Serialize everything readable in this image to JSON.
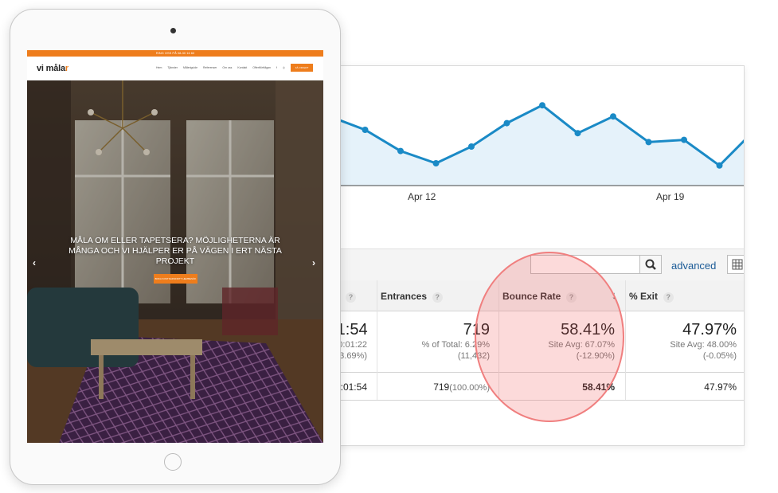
{
  "analytics": {
    "x_ticks": [
      "Apr 12",
      "Apr 19"
    ],
    "toolbar": {
      "advanced_label": "advanced"
    },
    "columns": [
      {
        "label": "Entrances"
      },
      {
        "label": "Bounce Rate"
      },
      {
        "label": "% Exit"
      }
    ],
    "summary_row": {
      "partial_time": ":01:54",
      "partial_time_sub1": "0:01:22",
      "partial_time_sub2": "3.69%)",
      "entrances": "719",
      "entrances_sub1": "% of Total: 6.29%",
      "entrances_sub2": "(11,432)",
      "bounce": "58.41%",
      "bounce_sub1": "Site Avg: 67.07%",
      "bounce_sub2": "(-12.90%)",
      "exit": "47.97%",
      "exit_sub1": "Site Avg: 48.00%",
      "exit_sub2": "(-0.05%)"
    },
    "total_row": {
      "partial_time": ":01:54",
      "entrances": "719",
      "entrances_pct": "(100.00%)",
      "bounce": "58.41%",
      "exit": "47.97%"
    }
  },
  "chart_data": {
    "type": "area",
    "x": [
      "",
      "",
      "",
      "",
      "",
      "",
      "",
      "",
      "",
      "",
      "",
      "",
      ""
    ],
    "x_tick_labels": [
      "Apr 12",
      "Apr 19"
    ],
    "series": [
      {
        "values": [
          62,
          50,
          31,
          20,
          35,
          56,
          72,
          47,
          62,
          39,
          41,
          18,
          50
        ]
      }
    ],
    "ylim": [
      0,
      100
    ],
    "colors": {
      "line": "#1a8ac6",
      "fill": "#e5f2fa"
    }
  },
  "tablet": {
    "topbar": "RING OSS PÅ 08-30 16 60",
    "logo_a": "vi måla",
    "logo_b": "r",
    "nav": [
      "Hem",
      "Tjänster",
      "Måleriguide",
      "Referenser",
      "Om oss",
      "Kontakt",
      "Offertförfrågan"
    ],
    "nav_cta": "FÅ OFFERT",
    "hero_text": "MÅLA OM ELLER TAPETSERA? MÖJLIGHETERNA ÄR MÅNGA OCH VI HJÄLPER ER PÅ VÄGEN I ERT NÄSTA PROJEKT",
    "hero_button": "BOKA KOSTNADSFRITT HEMBESÖK",
    "arrow_left": "‹",
    "arrow_right": "›"
  }
}
